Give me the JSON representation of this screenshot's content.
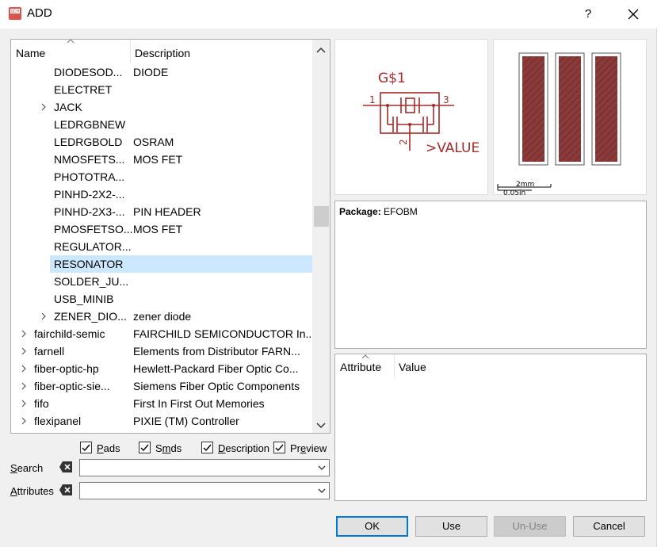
{
  "window": {
    "title": "ADD",
    "help_label": "?"
  },
  "tree": {
    "col_name": "Name",
    "col_description": "Description",
    "rows": [
      {
        "name": "DIODESOD...",
        "description": "DIODE",
        "level": 2,
        "expander": false,
        "selected": false
      },
      {
        "name": "ELECTRET",
        "description": "",
        "level": 2,
        "expander": false,
        "selected": false
      },
      {
        "name": "JACK",
        "description": "",
        "level": 2,
        "expander": true,
        "selected": false
      },
      {
        "name": "LEDRGBNEW",
        "description": "",
        "level": 2,
        "expander": false,
        "selected": false
      },
      {
        "name": "LEDRGBOLD",
        "description": "OSRAM",
        "level": 2,
        "expander": false,
        "selected": false
      },
      {
        "name": "NMOSFETS...",
        "description": "MOS FET",
        "level": 2,
        "expander": false,
        "selected": false
      },
      {
        "name": "PHOTOTRA...",
        "description": "",
        "level": 2,
        "expander": false,
        "selected": false
      },
      {
        "name": "PINHD-2X2-...",
        "description": "",
        "level": 2,
        "expander": false,
        "selected": false
      },
      {
        "name": "PINHD-2X3-...",
        "description": "PIN HEADER",
        "level": 2,
        "expander": false,
        "selected": false
      },
      {
        "name": "PMOSFETSO...",
        "description": "MOS FET",
        "level": 2,
        "expander": false,
        "selected": false
      },
      {
        "name": "REGULATOR...",
        "description": "",
        "level": 2,
        "expander": false,
        "selected": false
      },
      {
        "name": "RESONATOR",
        "description": "",
        "level": 2,
        "expander": false,
        "selected": true
      },
      {
        "name": "SOLDER_JU...",
        "description": "",
        "level": 2,
        "expander": false,
        "selected": false
      },
      {
        "name": "USB_MINIB",
        "description": "",
        "level": 2,
        "expander": false,
        "selected": false
      },
      {
        "name": "ZENER_DIO...",
        "description": "zener diode",
        "level": 2,
        "expander": true,
        "selected": false
      },
      {
        "name": "fairchild-semic",
        "description": "FAIRCHILD SEMICONDUCTOR In...",
        "level": 1,
        "expander": true,
        "selected": false
      },
      {
        "name": "farnell",
        "description": "Elements from Distributor FARN...",
        "level": 1,
        "expander": true,
        "selected": false
      },
      {
        "name": "fiber-optic-hp",
        "description": "Hewlett-Packard Fiber Optic Co...",
        "level": 1,
        "expander": true,
        "selected": false
      },
      {
        "name": "fiber-optic-sie...",
        "description": "Siemens Fiber Optic Components",
        "level": 1,
        "expander": true,
        "selected": false
      },
      {
        "name": "fifo",
        "description": "First In First Out Memories",
        "level": 1,
        "expander": true,
        "selected": false
      },
      {
        "name": "flexipanel",
        "description": "PIXIE (TM) Controller",
        "level": 1,
        "expander": true,
        "selected": false
      }
    ]
  },
  "options": {
    "pads": {
      "label": "Pads",
      "checked": true
    },
    "smds": {
      "label": "Smds",
      "checked": true
    },
    "description": {
      "label": "Description",
      "checked": true
    },
    "preview": {
      "label": "Preview",
      "checked": true
    }
  },
  "search": {
    "label": "Search",
    "value": ""
  },
  "attributes": {
    "label": "Attributes",
    "value": ""
  },
  "symbol": {
    "name": "G$1",
    "value": ">VALUE",
    "pin1": "1",
    "pin2": "2",
    "pin3": "3"
  },
  "package_preview": {
    "scale_mm": "2mm",
    "scale_in": "0.05in"
  },
  "package_info": {
    "label": "Package:",
    "value": "EFOBM"
  },
  "attribute_table": {
    "col_attribute": "Attribute",
    "col_value": "Value"
  },
  "buttons": {
    "ok": "OK",
    "use": "Use",
    "unuse": "Un-Use",
    "cancel": "Cancel"
  },
  "colors": {
    "selection": "#cce8ff",
    "symbol": "#a52a2a",
    "pad": "#8b3a3a",
    "default_button_border": "#0078d7"
  }
}
